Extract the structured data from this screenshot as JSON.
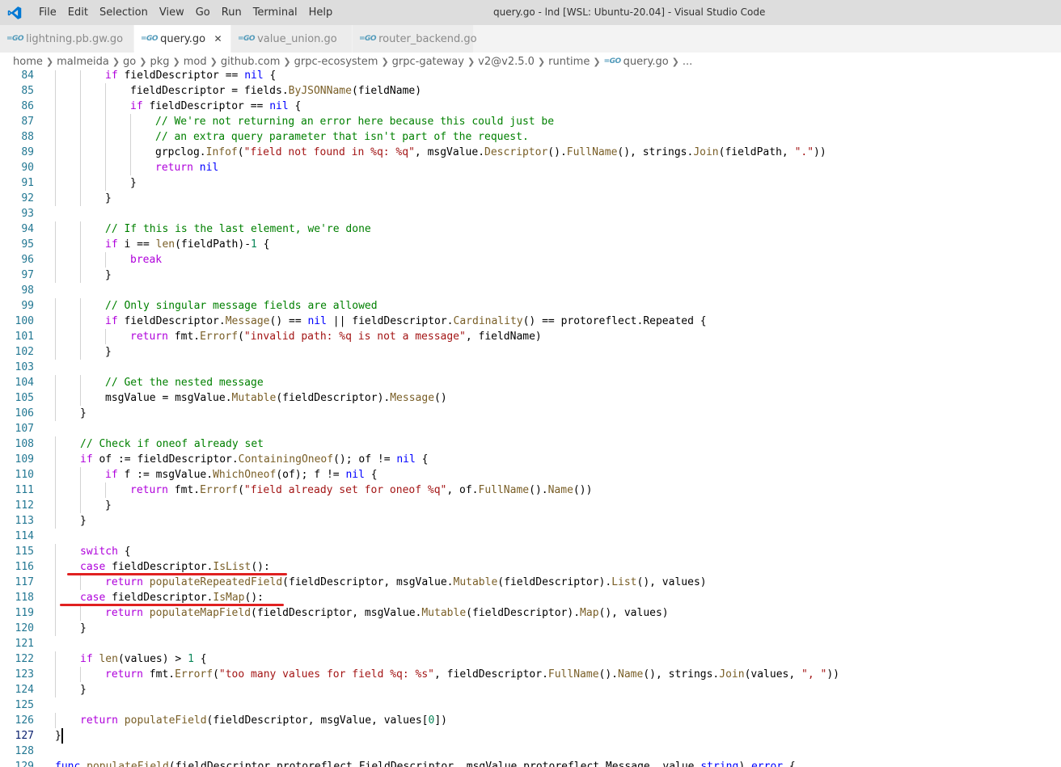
{
  "window": {
    "title": "query.go - lnd [WSL: Ubuntu-20.04] - Visual Studio Code",
    "menu": [
      "File",
      "Edit",
      "Selection",
      "View",
      "Go",
      "Run",
      "Terminal",
      "Help"
    ]
  },
  "tabs": [
    {
      "label": "lightning.pb.gw.go",
      "icon": "go-file-icon",
      "active": false
    },
    {
      "label": "query.go",
      "icon": "go-file-icon",
      "active": true
    },
    {
      "label": "value_union.go",
      "icon": "go-file-icon",
      "active": false
    },
    {
      "label": "router_backend.go",
      "icon": "go-file-icon",
      "active": false
    }
  ],
  "breadcrumb": [
    "home",
    "malmeida",
    "go",
    "pkg",
    "mod",
    "github.com",
    "grpc-ecosystem",
    "grpc-gateway",
    "v2@v2.5.0",
    "runtime",
    "query.go",
    "..."
  ],
  "colors": {
    "keyword_control": "#af00db",
    "keyword": "#0000ff",
    "comment": "#008000",
    "string": "#a31515",
    "function": "#795e26",
    "line_number": "#237893",
    "annotation": "#e02020"
  },
  "editor": {
    "current_line": 127,
    "lines": [
      {
        "n": 84,
        "t": "\t\tif fieldDescriptor == nil {"
      },
      {
        "n": 85,
        "t": "\t\t\tfieldDescriptor = fields.ByJSONName(fieldName)"
      },
      {
        "n": 86,
        "t": "\t\t\tif fieldDescriptor == nil {"
      },
      {
        "n": 87,
        "t": "\t\t\t\t// We're not returning an error here because this could just be"
      },
      {
        "n": 88,
        "t": "\t\t\t\t// an extra query parameter that isn't part of the request."
      },
      {
        "n": 89,
        "t": "\t\t\t\tgrpclog.Infof(\"field not found in %q: %q\", msgValue.Descriptor().FullName(), strings.Join(fieldPath, \".\"))"
      },
      {
        "n": 90,
        "t": "\t\t\t\treturn nil"
      },
      {
        "n": 91,
        "t": "\t\t\t}"
      },
      {
        "n": 92,
        "t": "\t\t}"
      },
      {
        "n": 93,
        "t": ""
      },
      {
        "n": 94,
        "t": "\t\t// If this is the last element, we're done"
      },
      {
        "n": 95,
        "t": "\t\tif i == len(fieldPath)-1 {"
      },
      {
        "n": 96,
        "t": "\t\t\tbreak"
      },
      {
        "n": 97,
        "t": "\t\t}"
      },
      {
        "n": 98,
        "t": ""
      },
      {
        "n": 99,
        "t": "\t\t// Only singular message fields are allowed"
      },
      {
        "n": 100,
        "t": "\t\tif fieldDescriptor.Message() == nil || fieldDescriptor.Cardinality() == protoreflect.Repeated {"
      },
      {
        "n": 101,
        "t": "\t\t\treturn fmt.Errorf(\"invalid path: %q is not a message\", fieldName)"
      },
      {
        "n": 102,
        "t": "\t\t}"
      },
      {
        "n": 103,
        "t": ""
      },
      {
        "n": 104,
        "t": "\t\t// Get the nested message"
      },
      {
        "n": 105,
        "t": "\t\tmsgValue = msgValue.Mutable(fieldDescriptor).Message()"
      },
      {
        "n": 106,
        "t": "\t}"
      },
      {
        "n": 107,
        "t": ""
      },
      {
        "n": 108,
        "t": "\t// Check if oneof already set"
      },
      {
        "n": 109,
        "t": "\tif of := fieldDescriptor.ContainingOneof(); of != nil {"
      },
      {
        "n": 110,
        "t": "\t\tif f := msgValue.WhichOneof(of); f != nil {"
      },
      {
        "n": 111,
        "t": "\t\t\treturn fmt.Errorf(\"field already set for oneof %q\", of.FullName().Name())"
      },
      {
        "n": 112,
        "t": "\t\t}"
      },
      {
        "n": 113,
        "t": "\t}"
      },
      {
        "n": 114,
        "t": ""
      },
      {
        "n": 115,
        "t": "\tswitch {"
      },
      {
        "n": 116,
        "t": "\tcase fieldDescriptor.IsList():"
      },
      {
        "n": 117,
        "t": "\t\treturn populateRepeatedField(fieldDescriptor, msgValue.Mutable(fieldDescriptor).List(), values)"
      },
      {
        "n": 118,
        "t": "\tcase fieldDescriptor.IsMap():"
      },
      {
        "n": 119,
        "t": "\t\treturn populateMapField(fieldDescriptor, msgValue.Mutable(fieldDescriptor).Map(), values)"
      },
      {
        "n": 120,
        "t": "\t}"
      },
      {
        "n": 121,
        "t": ""
      },
      {
        "n": 122,
        "t": "\tif len(values) > 1 {"
      },
      {
        "n": 123,
        "t": "\t\treturn fmt.Errorf(\"too many values for field %q: %s\", fieldDescriptor.FullName().Name(), strings.Join(values, \", \"))"
      },
      {
        "n": 124,
        "t": "\t}"
      },
      {
        "n": 125,
        "t": ""
      },
      {
        "n": 126,
        "t": "\treturn populateField(fieldDescriptor, msgValue, values[0])"
      },
      {
        "n": 127,
        "t": "}"
      },
      {
        "n": 128,
        "t": ""
      },
      {
        "n": 129,
        "t": "func populateField(fieldDescriptor protoreflect.FieldDescriptor, msgValue protoreflect.Message, value string) error {"
      }
    ],
    "annotations": [
      {
        "type": "red-underline",
        "line": 116
      },
      {
        "type": "red-underline",
        "line": 118
      }
    ]
  }
}
